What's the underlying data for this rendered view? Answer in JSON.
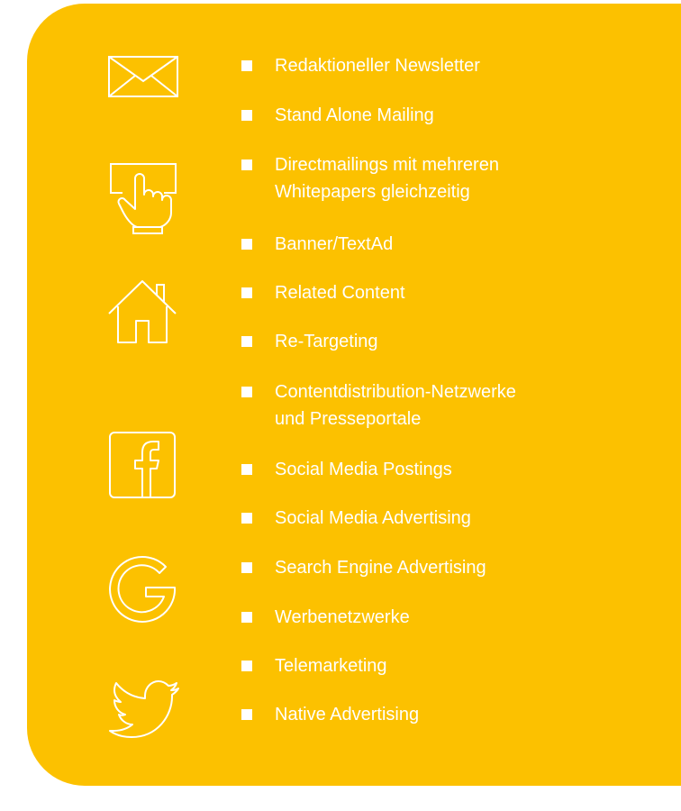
{
  "colors": {
    "panel_background": "#fcc100",
    "text": "#ffffff",
    "page_background": "#ffffff"
  },
  "icons": [
    "envelope-icon",
    "hand-click-icon",
    "house-icon",
    "facebook-icon",
    "google-icon",
    "twitter-icon"
  ],
  "channels": [
    {
      "label": "Redaktioneller Newsletter"
    },
    {
      "label": "Stand Alone Mailing"
    },
    {
      "label": "Directmailings mit mehreren",
      "label_line2": "Whitepapers gleichzeitig"
    },
    {
      "label": "Banner/TextAd"
    },
    {
      "label": "Related Content"
    },
    {
      "label": "Re-Targeting"
    },
    {
      "label": "Contentdistribution-Netzwerke",
      "label_line2": "und Presseportale"
    },
    {
      "label": "Social Media Postings"
    },
    {
      "label": "Social Media Advertising"
    },
    {
      "label": "Search Engine Advertising"
    },
    {
      "label": "Werbenetzwerke"
    },
    {
      "label": "Telemarketing"
    },
    {
      "label": "Native Advertising"
    }
  ]
}
